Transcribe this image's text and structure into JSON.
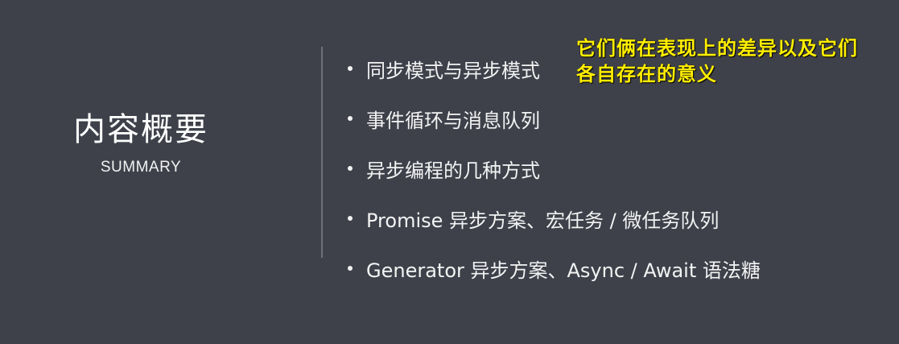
{
  "left": {
    "title": "内容概要",
    "subtitle": "SUMMARY"
  },
  "bullets": [
    "同步模式与异步模式",
    "事件循环与消息队列",
    "异步编程的几种方式",
    "Promise 异步方案、宏任务 / 微任务队列",
    "Generator 异步方案、Async / Await 语法糖"
  ],
  "annotation": {
    "line1": "它们俩在表现上的差异以及它们",
    "line2": "各自存在的意义"
  },
  "colors": {
    "background": "#3e414a",
    "text": "#f3f3f3",
    "annotation": "#ffee00",
    "divider": "#6e717a"
  }
}
